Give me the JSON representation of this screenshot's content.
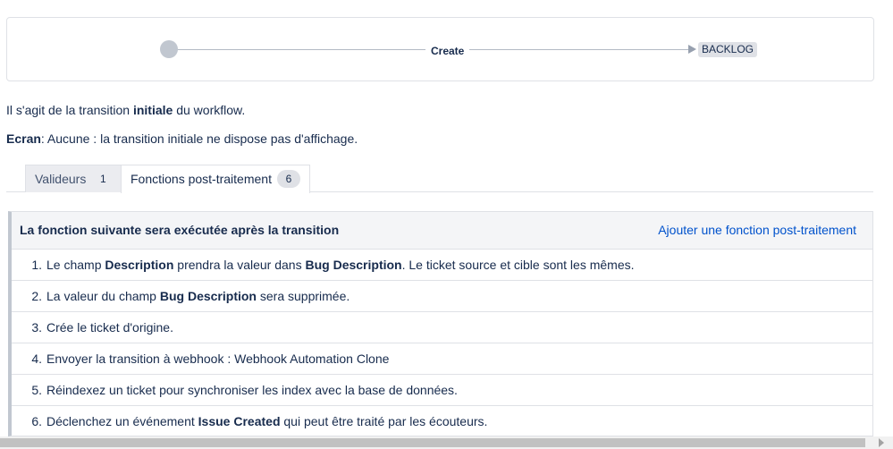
{
  "workflow": {
    "transition_name": "Create",
    "target_status": "BACKLOG"
  },
  "info": {
    "initial_pre": "Il s'agit de la transition ",
    "initial_bold": "initiale",
    "initial_post": " du workflow.",
    "screen_label": "Ecran",
    "screen_text": ": Aucune : la transition initiale ne dispose pas d'affichage."
  },
  "tabs": [
    {
      "label": "Valideurs",
      "count": "1"
    },
    {
      "label": "Fonctions post-traitement",
      "count": "6"
    }
  ],
  "panel": {
    "title": "La fonction suivante sera exécutée après la transition",
    "add_link": "Ajouter une fonction post-traitement"
  },
  "functions": [
    {
      "num": "1.",
      "p1": "Le champ ",
      "b1": "Description",
      "p2": " prendra la valeur dans ",
      "b2": "Bug Description",
      "p3": ". Le ticket source et cible sont les mêmes."
    },
    {
      "num": "2.",
      "p1": "La valeur du champ ",
      "b1": "Bug Description",
      "p2": " sera supprimée."
    },
    {
      "num": "3.",
      "p1": "Crée le ticket d'origine."
    },
    {
      "num": "4.",
      "p1": "Envoyer la transition à webhook : Webhook Automation Clone"
    },
    {
      "num": "5.",
      "p1": "Réindexez un ticket pour synchroniser les index avec la base de données."
    },
    {
      "num": "6.",
      "p1": "Déclenchez un événement ",
      "b1": "Issue Created",
      "p2": " qui peut être traité par les écouteurs."
    }
  ]
}
